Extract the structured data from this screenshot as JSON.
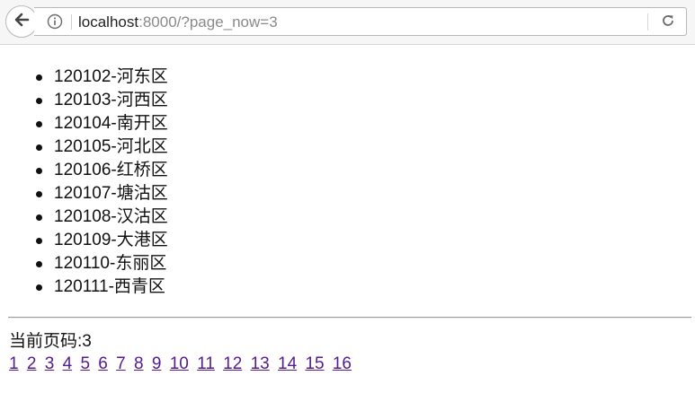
{
  "browser": {
    "url_host": "localhost",
    "url_rest": ":8000/?page_now=3",
    "back_icon": "arrow-left-icon",
    "info_icon": "info-icon",
    "reload_icon": "reload-icon"
  },
  "districts": [
    "120102-河东区",
    "120103-河西区",
    "120104-南开区",
    "120105-河北区",
    "120106-红桥区",
    "120107-塘沽区",
    "120108-汉沽区",
    "120109-大港区",
    "120110-东丽区",
    "120111-西青区"
  ],
  "page_info": "当前页码:3",
  "pager": [
    "1",
    "2",
    "3",
    "4",
    "5",
    "6",
    "7",
    "8",
    "9",
    "10",
    "11",
    "12",
    "13",
    "14",
    "15",
    "16"
  ],
  "colors": {
    "link": "#551a8b",
    "text": "#111111"
  }
}
